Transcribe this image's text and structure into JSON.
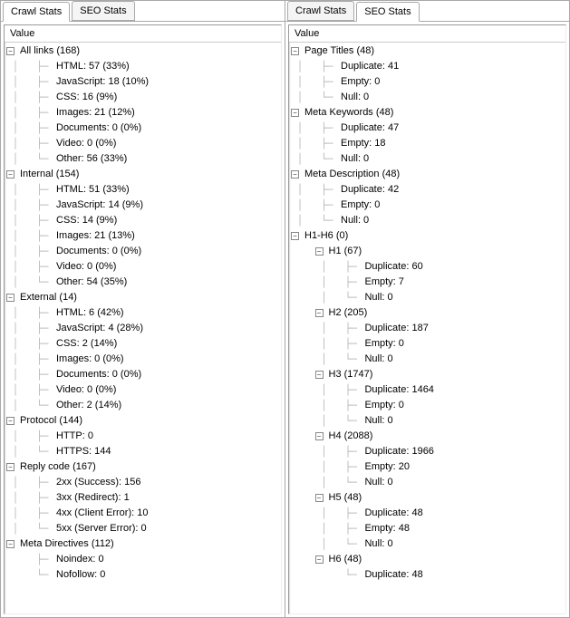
{
  "tabs": {
    "crawl_label": "Crawl Stats",
    "seo_label": "SEO Stats"
  },
  "column_header": "Value",
  "left_active": "crawl",
  "right_active": "seo",
  "crawl_tree": [
    {
      "label": "All links (168)",
      "children": [
        {
          "label": "HTML: 57 (33%)"
        },
        {
          "label": "JavaScript: 18 (10%)"
        },
        {
          "label": "CSS: 16 (9%)"
        },
        {
          "label": "Images: 21 (12%)"
        },
        {
          "label": "Documents: 0 (0%)"
        },
        {
          "label": "Video: 0 (0%)"
        },
        {
          "label": "Other: 56 (33%)"
        }
      ]
    },
    {
      "label": "Internal (154)",
      "children": [
        {
          "label": "HTML: 51 (33%)"
        },
        {
          "label": "JavaScript: 14 (9%)"
        },
        {
          "label": "CSS: 14 (9%)"
        },
        {
          "label": "Images: 21 (13%)"
        },
        {
          "label": "Documents: 0 (0%)"
        },
        {
          "label": "Video: 0 (0%)"
        },
        {
          "label": "Other: 54 (35%)"
        }
      ]
    },
    {
      "label": "External (14)",
      "children": [
        {
          "label": "HTML: 6 (42%)"
        },
        {
          "label": "JavaScript: 4 (28%)"
        },
        {
          "label": "CSS: 2 (14%)"
        },
        {
          "label": "Images: 0 (0%)"
        },
        {
          "label": "Documents: 0 (0%)"
        },
        {
          "label": "Video: 0 (0%)"
        },
        {
          "label": "Other: 2 (14%)"
        }
      ]
    },
    {
      "label": "Protocol (144)",
      "children": [
        {
          "label": "HTTP: 0"
        },
        {
          "label": "HTTPS: 144"
        }
      ]
    },
    {
      "label": "Reply code (167)",
      "children": [
        {
          "label": "2xx (Success): 156"
        },
        {
          "label": "3xx (Redirect): 1"
        },
        {
          "label": "4xx (Client Error): 10"
        },
        {
          "label": "5xx (Server Error): 0"
        }
      ]
    },
    {
      "label": "Meta Directives (112)",
      "children": [
        {
          "label": "Noindex: 0"
        },
        {
          "label": "Nofollow: 0"
        }
      ]
    }
  ],
  "seo_tree": [
    {
      "label": "Page Titles (48)",
      "children": [
        {
          "label": "Duplicate: 41"
        },
        {
          "label": "Empty: 0"
        },
        {
          "label": "Null: 0"
        }
      ]
    },
    {
      "label": "Meta Keywords (48)",
      "children": [
        {
          "label": "Duplicate: 47"
        },
        {
          "label": "Empty: 18"
        },
        {
          "label": "Null: 0"
        }
      ]
    },
    {
      "label": "Meta Description (48)",
      "children": [
        {
          "label": "Duplicate: 42"
        },
        {
          "label": "Empty: 0"
        },
        {
          "label": "Null: 0"
        }
      ]
    },
    {
      "label": "H1-H6 (0)",
      "children": [
        {
          "label": "H1 (67)",
          "children": [
            {
              "label": "Duplicate: 60"
            },
            {
              "label": "Empty: 7"
            },
            {
              "label": "Null: 0"
            }
          ]
        },
        {
          "label": "H2 (205)",
          "children": [
            {
              "label": "Duplicate: 187"
            },
            {
              "label": "Empty: 0"
            },
            {
              "label": "Null: 0"
            }
          ]
        },
        {
          "label": "H3 (1747)",
          "children": [
            {
              "label": "Duplicate: 1464"
            },
            {
              "label": "Empty: 0"
            },
            {
              "label": "Null: 0"
            }
          ]
        },
        {
          "label": "H4 (2088)",
          "children": [
            {
              "label": "Duplicate: 1966"
            },
            {
              "label": "Empty: 20"
            },
            {
              "label": "Null: 0"
            }
          ]
        },
        {
          "label": "H5 (48)",
          "children": [
            {
              "label": "Duplicate: 48"
            },
            {
              "label": "Empty: 48"
            },
            {
              "label": "Null: 0"
            }
          ]
        },
        {
          "label": "H6 (48)",
          "children": [
            {
              "label": "Duplicate: 48"
            }
          ]
        }
      ]
    }
  ]
}
